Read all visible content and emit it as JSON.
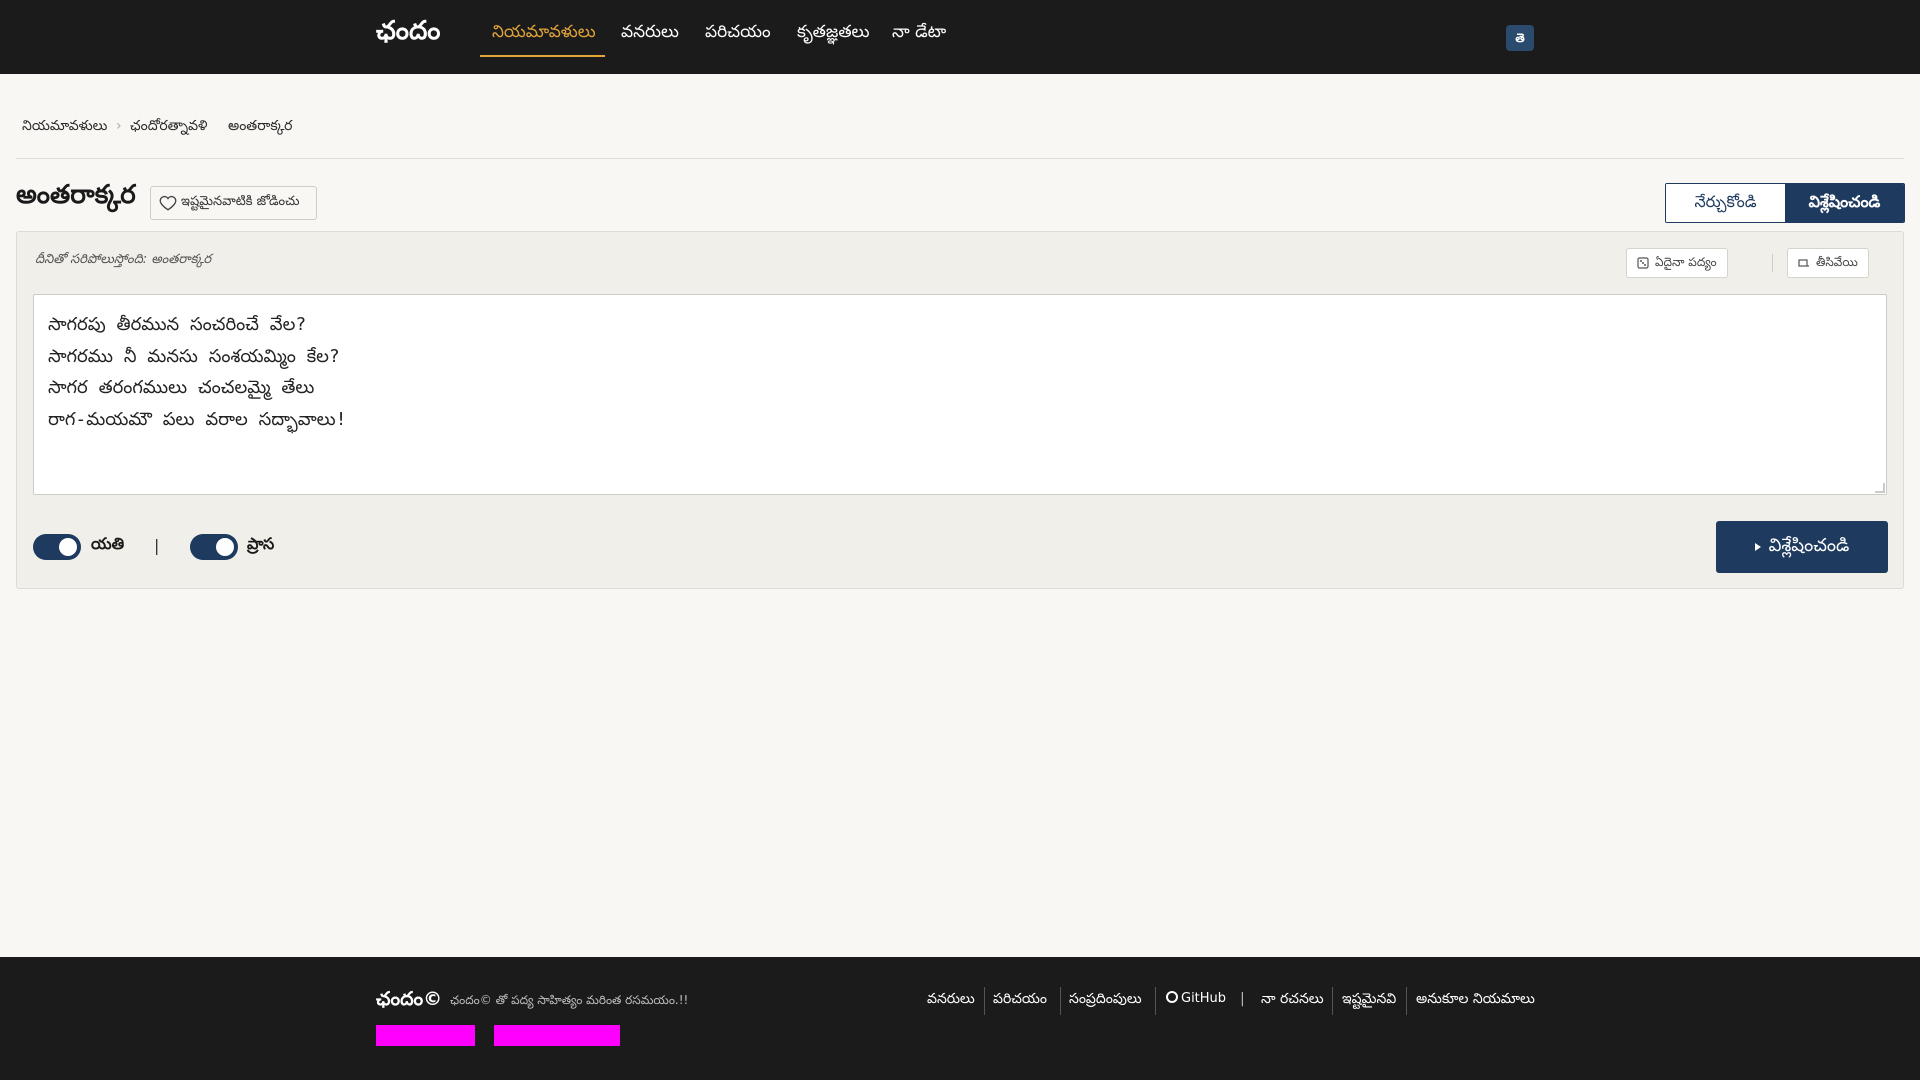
{
  "nav": {
    "brand": "ఛందం",
    "links": [
      "నియమావళులు",
      "వనరులు",
      "పరిచయం",
      "కృతజ్ఞతలు",
      "నా డేటా"
    ],
    "active_index": 0,
    "lang_button": "తె"
  },
  "breadcrumb": [
    "నియమావళులు",
    "ఛందోరత్నావళి",
    "అంతరాక్కర"
  ],
  "title": "అంతరాక్కర",
  "favorite_label": "ఇష్టమైనవాటికి జోడించు",
  "mode_tabs": {
    "learn": "నేర్చుకోండి",
    "analyze": "విశ్లేషించండి",
    "selected": "analyze"
  },
  "match_text": "దీనితో సరిపోలుస్తోంది: అంతరాక్కర",
  "tools": {
    "random_poem": "ఏదైనా పద్యం",
    "clear": "తీసివేయి"
  },
  "poem": "సాగరపు తీరమున సంచరించే వేల?\nసాగరము నీ మనసు సంశయమ్మిం కేల?\nసాగర తరంగములు చంచలమ్మై తేలు\nరాగ-మయమౌ పలు వరాల సద్భావాలు!",
  "toggles": {
    "yati": {
      "label": "యతి",
      "on": true
    },
    "prasa": {
      "label": "ప్రాస",
      "on": true
    },
    "separator": "|"
  },
  "analyze_button": "విశ్లేషించండి",
  "footer": {
    "brand": "ఛందం©",
    "tagline": "ఛందం© తో పద్య సాహిత్యం మరింత రసమయం.!!",
    "links": [
      "వనరులు",
      "పరిచయం",
      "సంప్రదింపులు",
      "GitHub",
      "నా రచనలు",
      "ఇష్టమైనవి",
      "అనుకూల నియమాలు"
    ],
    "separator": "|"
  },
  "colors": {
    "navbar": "#1b1b1b",
    "accent": "#e1a43a",
    "primary": "#1e3a5f",
    "background": "#f8f7f4",
    "badge": "#ff00ff"
  }
}
